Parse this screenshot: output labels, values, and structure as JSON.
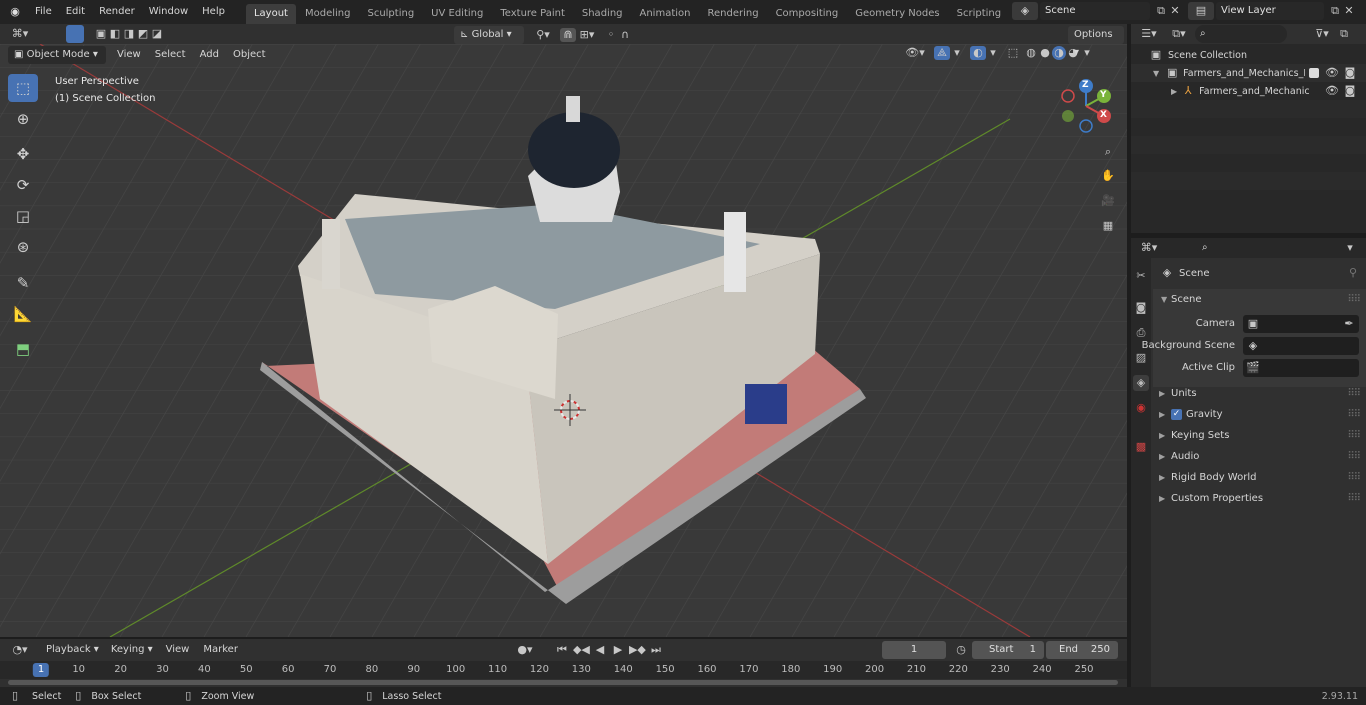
{
  "topbar": {
    "menus": [
      "File",
      "Edit",
      "Render",
      "Window",
      "Help"
    ],
    "workspaces": [
      "Layout",
      "Modeling",
      "Sculpting",
      "UV Editing",
      "Texture Paint",
      "Shading",
      "Animation",
      "Rendering",
      "Compositing",
      "Geometry Nodes",
      "Scripting"
    ],
    "active_workspace": "Layout",
    "add_tab": "+",
    "scene": "Scene",
    "view_layer": "View Layer"
  },
  "viewport": {
    "mode": "Object Mode",
    "menus": [
      "View",
      "Select",
      "Add",
      "Object"
    ],
    "transform": "Global",
    "options": "Options",
    "overlay_line1": "User Perspective",
    "overlay_line2": "(1) Scene Collection",
    "gizmo": {
      "z": "Z",
      "y": "Y",
      "x": "X"
    }
  },
  "outliner": {
    "root": "Scene Collection",
    "items": [
      {
        "label": "Farmers_and_Mechanics_Ban"
      },
      {
        "label": "Farmers_and_Mechanics_"
      }
    ]
  },
  "properties": {
    "context": "Scene",
    "panel_title": "Scene",
    "camera_label": "Camera",
    "bg_scene_label": "Background Scene",
    "active_clip_label": "Active Clip",
    "sections": [
      "Units",
      "Gravity",
      "Keying Sets",
      "Audio",
      "Rigid Body World",
      "Custom Properties"
    ],
    "gravity_checked": true
  },
  "timeline": {
    "menus": [
      "Playback",
      "Keying",
      "View",
      "Marker"
    ],
    "current_frame": "1",
    "start_label": "Start",
    "start": "1",
    "end_label": "End",
    "end": "250",
    "ruler": [
      "1",
      "10",
      "20",
      "30",
      "40",
      "50",
      "60",
      "70",
      "80",
      "90",
      "100",
      "110",
      "120",
      "130",
      "140",
      "150",
      "160",
      "170",
      "180",
      "190",
      "200",
      "210",
      "220",
      "230",
      "240",
      "250"
    ]
  },
  "status": {
    "select": "Select",
    "box_select": "Box Select",
    "zoom_view": "Zoom View",
    "lasso_select": "Lasso Select",
    "version": "2.93.11"
  },
  "colors": {
    "accent": "#4772b3",
    "axis_x": "#cf4a4a",
    "axis_y": "#7ab33a",
    "axis_z": "#3e7cc9"
  }
}
